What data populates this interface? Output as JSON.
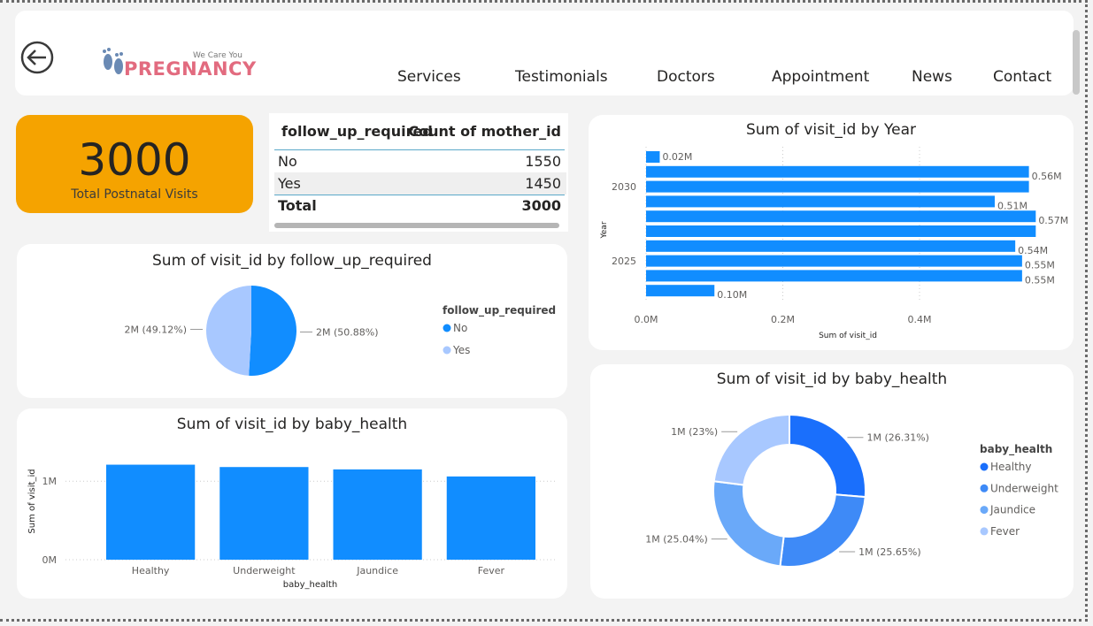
{
  "header": {
    "logo_tagline": "We Care You",
    "logo_text": "PREGNANCY",
    "nav": [
      "Services",
      "Testimonials",
      "Doctors",
      "Appointment",
      "News",
      "Contact"
    ]
  },
  "kpi": {
    "value": "3000",
    "label": "Total Postnatal Visits",
    "color": "#f5a300"
  },
  "table": {
    "columns": [
      "follow_up_required",
      "Count of mother_id"
    ],
    "rows": [
      [
        "No",
        "1550"
      ],
      [
        "Yes",
        "1450"
      ]
    ],
    "total": [
      "Total",
      "3000"
    ]
  },
  "chart_data": [
    {
      "type": "pie",
      "title": "Sum of visit_id by follow_up_required",
      "legend_title": "follow_up_required",
      "legend_position": "right",
      "categories": [
        "No",
        "Yes"
      ],
      "values": [
        50.88,
        49.12
      ],
      "labels": [
        "2M (50.88%)",
        "2M (49.12%)"
      ],
      "colors": [
        "#118dff",
        "#a8c8ff"
      ]
    },
    {
      "type": "bar",
      "orientation": "horizontal",
      "title": "Sum of visit_id by Year",
      "xlabel": "Sum of visit_id",
      "ylabel": "Year",
      "ytick_labels": [
        "2030",
        "2025"
      ],
      "xtick_labels": [
        "0.0M",
        "0.2M",
        "0.4M"
      ],
      "xlim": [
        0,
        0.6
      ],
      "values": [
        0.02,
        0.56,
        0.56,
        0.51,
        0.57,
        0.57,
        0.54,
        0.55,
        0.55,
        0.1
      ],
      "data_labels": [
        "0.02M",
        "0.56M",
        "",
        "0.51M",
        "0.57M",
        "",
        "0.54M",
        "0.55M",
        "0.55M",
        "0.10M"
      ],
      "color": "#118dff"
    },
    {
      "type": "bar",
      "title": "Sum of visit_id by baby_health",
      "xlabel": "baby_health",
      "ylabel": "Sum of visit_id",
      "categories": [
        "Healthy",
        "Underweight",
        "Jaundice",
        "Fever"
      ],
      "values": [
        1.21,
        1.18,
        1.15,
        1.06
      ],
      "ytick_labels": [
        "1M",
        "0M"
      ],
      "ylim": [
        0,
        1.25
      ],
      "color": "#118dff"
    },
    {
      "type": "pie",
      "donut": true,
      "title": "Sum of visit_id by baby_health",
      "legend_title": "baby_health",
      "legend_position": "right",
      "categories": [
        "Healthy",
        "Underweight",
        "Jaundice",
        "Fever"
      ],
      "values": [
        26.31,
        25.65,
        25.04,
        23.0
      ],
      "labels": [
        "1M (26.31%)",
        "1M (25.65%)",
        "1M (25.04%)",
        "1M (23%)"
      ],
      "colors": [
        "#1a6ffc",
        "#3e8af7",
        "#6aa9f9",
        "#a8c8ff"
      ]
    }
  ]
}
